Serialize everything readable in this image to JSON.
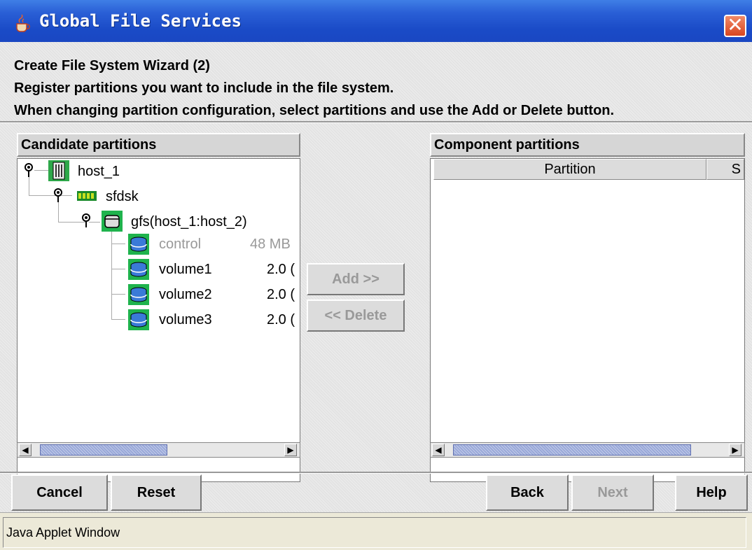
{
  "window": {
    "title": "Global File Services",
    "title_icon": "java-cup-icon",
    "close_icon": "close-icon"
  },
  "header": {
    "line1": "Create File System Wizard (2)",
    "line2": "Register partitions you want to include in the file system.",
    "line3": "When changing partition configuration, select partitions and use the Add or Delete button."
  },
  "candidate": {
    "title": "Candidate partitions",
    "tree": [
      {
        "label": "host_1",
        "icon": "host-icon"
      },
      {
        "label": "sfdsk",
        "icon": "disk-class-icon"
      },
      {
        "label": "gfs(host_1:host_2)",
        "icon": "disk-group-icon"
      },
      {
        "label": "control",
        "size": "48 MB",
        "icon": "volume-icon",
        "dimmed": true
      },
      {
        "label": "volume1",
        "size": "2.0 (",
        "icon": "volume-icon"
      },
      {
        "label": "volume2",
        "size": "2.0 (",
        "icon": "volume-icon"
      },
      {
        "label": "volume3",
        "size": "2.0 (",
        "icon": "volume-icon"
      }
    ]
  },
  "middle": {
    "add_label": "Add >>",
    "delete_label": "<< Delete"
  },
  "component": {
    "title": "Component partitions",
    "columns": [
      "Partition",
      "S"
    ]
  },
  "footer": {
    "cancel": "Cancel",
    "reset": "Reset",
    "back": "Back",
    "next": "Next",
    "help": "Help"
  },
  "status": {
    "text": "Java Applet Window"
  },
  "colors": {
    "titlebar": "#2a5fd6",
    "node_icon": "#1fb34d",
    "scroll_thumb": "#9aa9d9"
  }
}
